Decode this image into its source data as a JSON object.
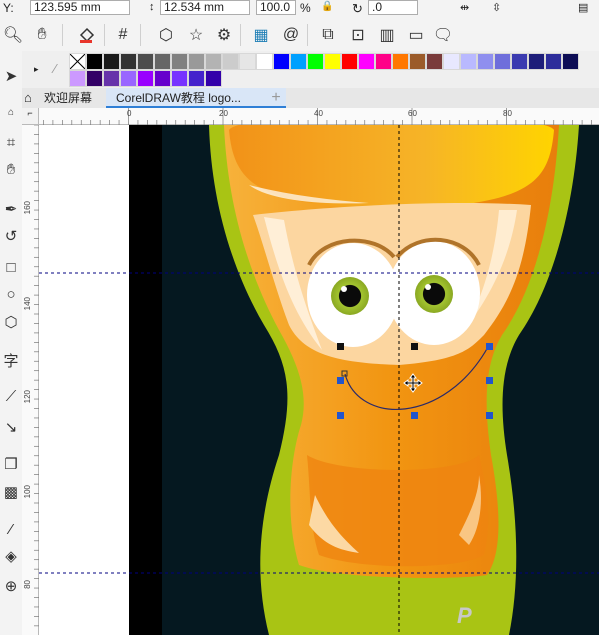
{
  "property_bar": {
    "y_label": "Y:",
    "y_value": "123.595 mm",
    "height_value": "12.534 mm",
    "scale_value": "100.0",
    "percent": "%",
    "angle_value": ".0"
  },
  "toolbar": {
    "icons": [
      "zoom-icon",
      "pan-hand-icon",
      "fill-bucket-icon",
      "snap-grid-icon",
      "polygon-icon",
      "star-icon",
      "gear-icon",
      "table-grid-icon",
      "spiral-icon",
      "shape-tool-icon",
      "connector-icon",
      "chart-icon",
      "callout-icon"
    ]
  },
  "palette": {
    "row1": [
      "#000000",
      "#1a1a1a",
      "#333333",
      "#4d4d4d",
      "#666666",
      "#808080",
      "#999999",
      "#b3b3b3",
      "#cccccc",
      "#e6e6e6",
      "#ffffff",
      "#0000ff",
      "#00a0ff",
      "#00ff00",
      "#ffff00",
      "#ff0000",
      "#ff00ff",
      "#ff0088",
      "#ff7700",
      "#9b5b2a",
      "#7a3b3b",
      "#e8e8ff",
      "#b9b9ff",
      "#8f8fef",
      "#6e6edb",
      "#3b3bb0",
      "#1e1e7a",
      "#2d2d9b",
      "#0d0d55"
    ],
    "row2": [
      "#cc99ff",
      "#330066",
      "#6633aa",
      "#9966ff",
      "#9900ff",
      "#6600cc",
      "#7733ff",
      "#4422cc",
      "#3300aa"
    ]
  },
  "tabs": {
    "home_label": "欢迎屏幕",
    "doc_label": "CorelDRAW教程 logo...",
    "add_label": "+"
  },
  "ruler_top": {
    "ticks": [
      "0",
      "20",
      "40",
      "60",
      "80"
    ]
  },
  "ruler_left": {
    "ticks": [
      "160",
      "140",
      "120",
      "100",
      "80"
    ]
  },
  "canvas": {
    "background_color": "#051820",
    "page_color": "#ffffff",
    "cup_outer_color": "#a9c414",
    "cup_inner_color": "#f39a14",
    "selection_color": "#2255cc",
    "guide_color": "#000080"
  },
  "watermark": {
    "text": "P"
  }
}
